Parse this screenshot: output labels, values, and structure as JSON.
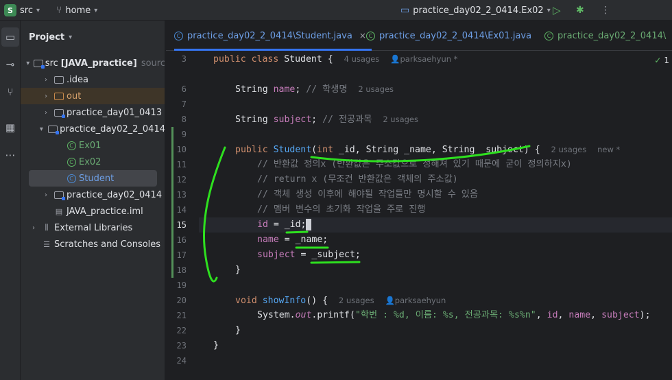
{
  "topbar": {
    "project_badge": "S",
    "project_name": "src",
    "branch": "home",
    "run_config": "practice_day02_2_0414.Ex02"
  },
  "activity": {
    "icons": [
      "folder-icon",
      "commit-icon",
      "pull-requests-icon",
      "structure-icon",
      "more-icon"
    ]
  },
  "project_panel": {
    "title": "Project",
    "tree": [
      {
        "label": "src",
        "bold_suffix": "[JAVA_practice]",
        "dim_suffix": "sourc",
        "indent": 0,
        "arrow": "▾",
        "icon": "module"
      },
      {
        "label": ".idea",
        "indent": 1,
        "arrow": "›",
        "icon": "folder"
      },
      {
        "label": "out",
        "indent": 1,
        "arrow": "›",
        "icon": "folder-orange"
      },
      {
        "label": "practice_day01_0413",
        "indent": 1,
        "arrow": "›",
        "icon": "package"
      },
      {
        "label": "practice_day02_2_0414",
        "indent": 1,
        "arrow": "▾",
        "icon": "package"
      },
      {
        "label": "Ex01",
        "indent": 2,
        "arrow": "",
        "icon": "class-green"
      },
      {
        "label": "Ex02",
        "indent": 2,
        "arrow": "",
        "icon": "class-green"
      },
      {
        "label": "Student",
        "indent": 2,
        "arrow": "",
        "icon": "class"
      },
      {
        "label": "practice_day02_0414",
        "indent": 1,
        "arrow": "›",
        "icon": "package"
      },
      {
        "label": "JAVA_practice.iml",
        "indent": 1,
        "arrow": "",
        "icon": "file"
      },
      {
        "label": "External Libraries",
        "indent": 0,
        "arrow": "›",
        "icon": "library"
      },
      {
        "label": "Scratches and Consoles",
        "indent": 0,
        "arrow": "",
        "icon": "scratches"
      }
    ]
  },
  "tabs": [
    {
      "label": "practice_day02_2_0414\\Student.java",
      "active": true
    },
    {
      "label": "practice_day02_2_0414\\Ex01.java",
      "active": false
    },
    {
      "label": "practice_day02_2_0414\\",
      "active": false
    }
  ],
  "editor": {
    "problems_count": "1",
    "hints": {
      "line3": "4 usages",
      "line3_author": "parksaehyun *",
      "line6": "2 usages",
      "line8": "2 usages",
      "line10": "2 usages",
      "line10_new": "new *",
      "line20": "2 usages",
      "line20_author": "parksaehyun"
    },
    "line_numbers": [
      "3",
      "",
      "6",
      "7",
      "8",
      "9",
      "10",
      "11",
      "12",
      "13",
      "14",
      "15",
      "16",
      "17",
      "18",
      "19",
      "20",
      "21",
      "22",
      "23",
      "24"
    ],
    "text": {
      "l3_kw": "public class",
      "l3_name": "Student",
      "l3_brace": "{",
      "l6_type": "String",
      "l6_field": "name",
      "l6_comment": "// 학생명",
      "l8_type": "String",
      "l8_field": "subject",
      "l8_comment": "// 전공과목",
      "l10_kw": "public",
      "l10_name": "Student",
      "l10_params_a": "(",
      "l10_int": "int",
      "l10_params_b": " _id, String _name, String _subject) {",
      "l11": "// 반환값 정의x (반환값은 주소값으로 정해져 있기 때문에 굳이 정의하지x)",
      "l12": "// return x (무조건 반환값은 객체의 주소값)",
      "l13": "// 객체 생성 이후에 해야될 작업들만 명시할 수 있음",
      "l14": "// 멤버 변수의 초기화 작업을 주로 진행",
      "l15_field": "id",
      "l15_rest": " = _id;",
      "l16_field": "name",
      "l16_rest": " = _name;",
      "l17_field": "subject",
      "l17_rest": " = _subject;",
      "l18": "}",
      "l20_kw": "void",
      "l20_name": "showInfo",
      "l20_rest": "() {",
      "l21_a": "System.",
      "l21_out": "out",
      "l21_b": ".printf(",
      "l21_str": "\"학번 : %d, 이름: %s, 전공과목: %s%n\"",
      "l21_c": ", ",
      "l21_id": "id",
      "l21_d": ", ",
      "l21_name": "name",
      "l21_e": ", ",
      "l21_subject": "subject",
      "l21_f": ");",
      "l22": "}",
      "l23": "}"
    }
  },
  "colors": {
    "accent": "#3574f0",
    "annotation_green": "#2ee01f",
    "keyword": "#cf8e6d",
    "field": "#c77dbb",
    "function": "#56a8f5",
    "string": "#6aab73",
    "comment": "#7a7e85"
  }
}
